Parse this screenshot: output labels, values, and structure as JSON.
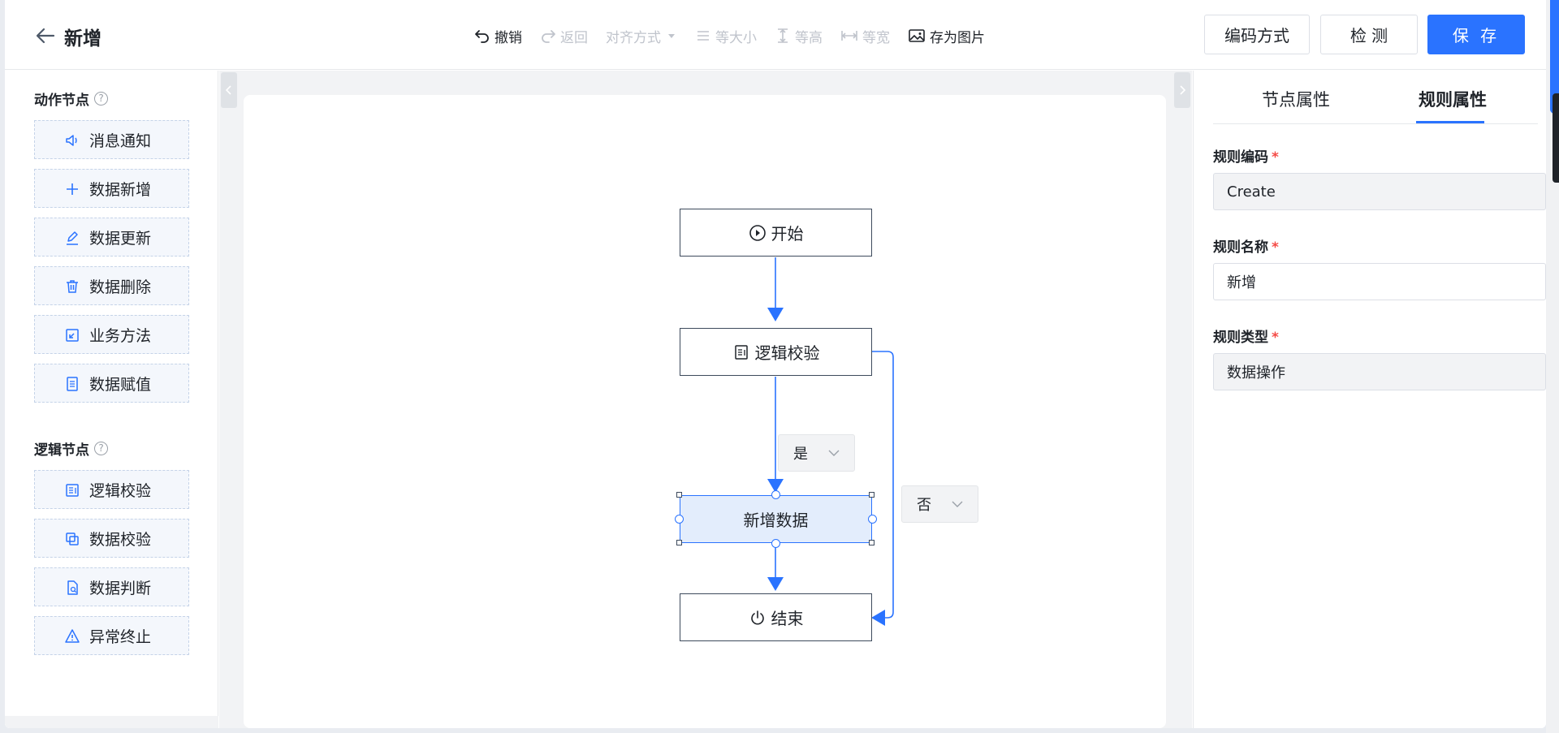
{
  "header": {
    "title": "新增",
    "buttons": {
      "encoding": "编码方式",
      "check": "检 测",
      "save": "保 存"
    }
  },
  "toolbar": {
    "undo": "撤销",
    "redo": "返回",
    "align": "对齐方式",
    "same_size": "等大小",
    "same_height": "等高",
    "same_width": "等宽",
    "save_image": "存为图片"
  },
  "palette": {
    "action_title": "动作节点",
    "logic_title": "逻辑节点",
    "help": "?",
    "action_items": [
      {
        "label": "消息通知",
        "icon": "speaker-icon"
      },
      {
        "label": "数据新增",
        "icon": "plus-icon"
      },
      {
        "label": "数据更新",
        "icon": "pencil-icon"
      },
      {
        "label": "数据删除",
        "icon": "trash-icon"
      },
      {
        "label": "业务方法",
        "icon": "method-icon"
      },
      {
        "label": "数据赋值",
        "icon": "document-icon"
      }
    ],
    "logic_items": [
      {
        "label": "逻辑校验",
        "icon": "checklist-icon"
      },
      {
        "label": "数据校验",
        "icon": "copy-icon"
      },
      {
        "label": "数据判断",
        "icon": "file-search-icon"
      },
      {
        "label": "异常终止",
        "icon": "warning-icon"
      }
    ]
  },
  "flow": {
    "nodes": {
      "start": "开始",
      "logic_check": "逻辑校验",
      "add_data": "新增数据",
      "end": "结束"
    },
    "edge_labels": {
      "yes": "是",
      "no": "否"
    }
  },
  "properties": {
    "tabs": [
      "节点属性",
      "规则属性"
    ],
    "active_tab": "规则属性",
    "fields": [
      {
        "label": "规则编码",
        "value": "Create",
        "required": true,
        "editable": false
      },
      {
        "label": "规则名称",
        "value": "新增",
        "required": true,
        "editable": true
      },
      {
        "label": "规则类型",
        "value": "数据操作",
        "required": true,
        "editable": false
      }
    ],
    "required_mark": "*"
  },
  "colors": {
    "primary": "#2a73ff",
    "node_border": "#3d4a5c",
    "selected_fill": "#e3edfc",
    "required": "#f54a45"
  }
}
